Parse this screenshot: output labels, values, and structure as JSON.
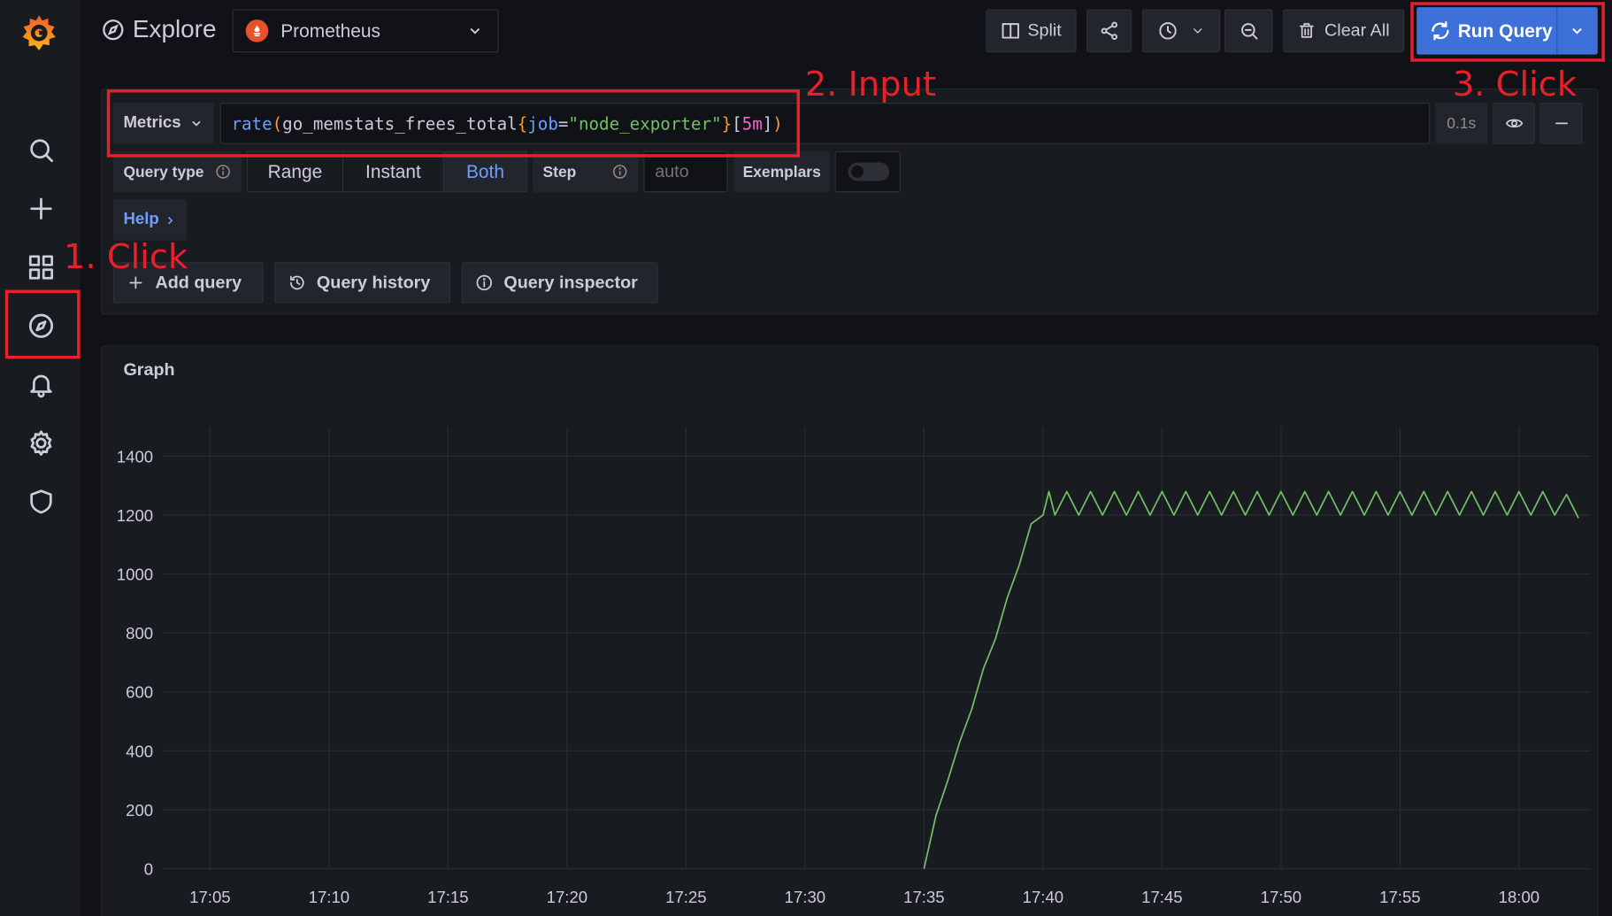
{
  "header": {
    "title": "Explore",
    "datasource": "Prometheus",
    "split_label": "Split",
    "clear_all_label": "Clear All",
    "run_query_label": "Run Query"
  },
  "sidebar": {
    "items": [
      "search-icon",
      "plus-icon",
      "dashboards-icon",
      "explore-compass-icon",
      "bell-icon",
      "gear-icon",
      "shield-icon"
    ]
  },
  "query": {
    "metrics_label": "Metrics",
    "expression_parts": {
      "fn": "rate",
      "open": "(",
      "metric": "go_memstats_frees_total",
      "brace_open": "{",
      "label_key": "job",
      "eq": "=",
      "label_value": "\"node_exporter\"",
      "brace_close": "}",
      "range_open": "[",
      "range": "5m",
      "range_close": "]",
      "close": ")"
    },
    "duration": "0.1s",
    "query_type_label": "Query type",
    "type_options": [
      "Range",
      "Instant",
      "Both"
    ],
    "selected_type": "Both",
    "step_label": "Step",
    "step_placeholder": "auto",
    "exemplars_label": "Exemplars",
    "help_label": "Help"
  },
  "actions": {
    "add_query": "Add query",
    "query_history": "Query history",
    "query_inspector": "Query inspector"
  },
  "annotations": {
    "step1": "1. Click",
    "step2": "2. Input",
    "step3": "3. Click"
  },
  "graph": {
    "title": "Graph"
  },
  "chart_data": {
    "type": "line",
    "title": "Graph",
    "ylim": [
      0,
      1500
    ],
    "yticks": [
      0,
      200,
      400,
      600,
      800,
      1000,
      1200,
      1400
    ],
    "xticks": [
      "17:05",
      "17:10",
      "17:15",
      "17:20",
      "17:25",
      "17:30",
      "17:35",
      "17:40",
      "17:45",
      "17:50",
      "17:55",
      "18:00"
    ],
    "xlim": [
      "17:03",
      "18:03"
    ],
    "grid": true,
    "line_color": "#73bf69",
    "series": [
      {
        "values": [
          [
            "17:35",
            0
          ],
          [
            "17:35.5",
            180
          ],
          [
            "17:36",
            300
          ],
          [
            "17:36.5",
            430
          ],
          [
            "17:37",
            540
          ],
          [
            "17:37.5",
            680
          ],
          [
            "17:38",
            780
          ],
          [
            "17:38.5",
            920
          ],
          [
            "17:39",
            1030
          ],
          [
            "17:39.5",
            1170
          ],
          [
            "17:40",
            1200
          ],
          [
            "17:40.25",
            1280
          ],
          [
            "17:40.5",
            1200
          ],
          [
            "17:41",
            1280
          ],
          [
            "17:41.5",
            1200
          ],
          [
            "17:42",
            1280
          ],
          [
            "17:42.5",
            1200
          ],
          [
            "17:43",
            1280
          ],
          [
            "17:43.5",
            1200
          ],
          [
            "17:44",
            1280
          ],
          [
            "17:44.5",
            1200
          ],
          [
            "17:45",
            1280
          ],
          [
            "17:45.5",
            1200
          ],
          [
            "17:46",
            1280
          ],
          [
            "17:46.5",
            1200
          ],
          [
            "17:47",
            1280
          ],
          [
            "17:47.5",
            1200
          ],
          [
            "17:48",
            1280
          ],
          [
            "17:48.5",
            1200
          ],
          [
            "17:49",
            1280
          ],
          [
            "17:49.5",
            1200
          ],
          [
            "17:50",
            1280
          ],
          [
            "17:50.5",
            1200
          ],
          [
            "17:51",
            1280
          ],
          [
            "17:51.5",
            1200
          ],
          [
            "17:52",
            1280
          ],
          [
            "17:52.5",
            1200
          ],
          [
            "17:53",
            1280
          ],
          [
            "17:53.5",
            1200
          ],
          [
            "17:54",
            1280
          ],
          [
            "17:54.5",
            1200
          ],
          [
            "17:55",
            1280
          ],
          [
            "17:55.5",
            1200
          ],
          [
            "17:56",
            1280
          ],
          [
            "17:56.5",
            1200
          ],
          [
            "17:57",
            1280
          ],
          [
            "17:57.5",
            1200
          ],
          [
            "17:58",
            1280
          ],
          [
            "17:58.5",
            1200
          ],
          [
            "17:59",
            1280
          ],
          [
            "17:59.5",
            1200
          ],
          [
            "18:00",
            1280
          ],
          [
            "18:00.5",
            1200
          ],
          [
            "18:01",
            1280
          ],
          [
            "18:01.5",
            1200
          ],
          [
            "18:02",
            1270
          ],
          [
            "18:02.5",
            1190
          ]
        ]
      }
    ]
  }
}
